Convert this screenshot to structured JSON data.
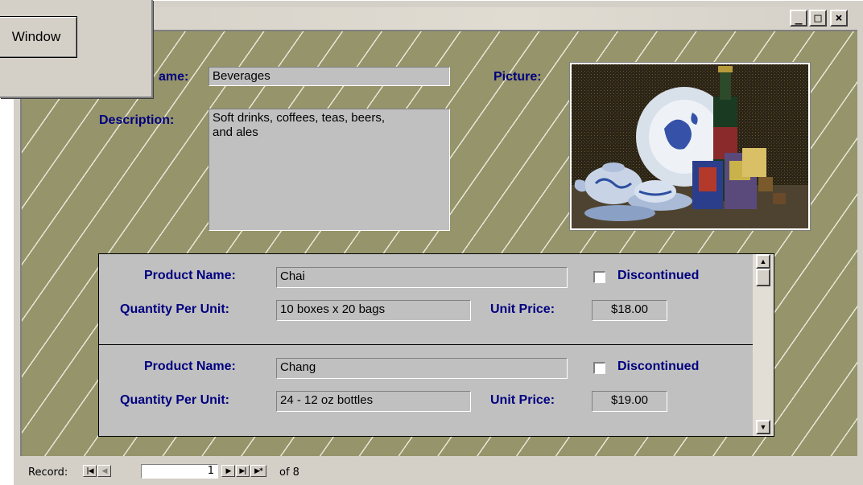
{
  "window": {
    "buttons": {
      "minimize": "_",
      "maximize": "□",
      "close": "×"
    }
  },
  "category": {
    "name_label": "ame:",
    "name_value": "Beverages",
    "description_label": "Description:",
    "description_value": "Soft drinks, coffees, teas, beers,\nand ales",
    "picture_label": "Picture:"
  },
  "products": [
    {
      "product_name_label": "Product Name:",
      "product_name": "Chai",
      "discontinued_label": "Discontinued",
      "discontinued": false,
      "qpu_label": "Quantity Per Unit:",
      "qpu": "10 boxes x 20 bags",
      "price_label": "Unit Price:",
      "price": "$18.00"
    },
    {
      "product_name_label": "Product Name:",
      "product_name": "Chang",
      "discontinued_label": "Discontinued",
      "discontinued": false,
      "qpu_label": "Quantity Per Unit:",
      "qpu": "24 - 12 oz bottles",
      "price_label": "Unit Price:",
      "price": "$19.00"
    }
  ],
  "navigation": {
    "record_label": "Record:",
    "current": "1",
    "of_label": "of 8",
    "first_icon": "first-record-icon",
    "prev_icon": "previous-record-icon",
    "next_icon": "next-record-icon",
    "last_icon": "last-record-icon",
    "new_icon": "new-record-icon"
  },
  "popup": {
    "button_label": "Window"
  },
  "colors": {
    "form_bg": "#95946a",
    "label": "#00007f",
    "chrome": "#d4d0c8",
    "field": "#c0c0c0"
  }
}
